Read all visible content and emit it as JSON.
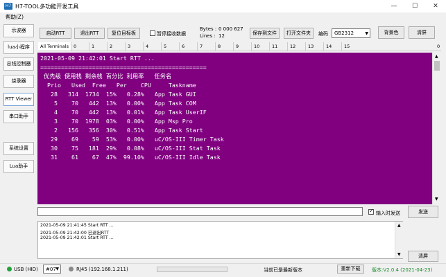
{
  "window": {
    "title": "H7-TOOL多功能开发工具",
    "icon_text": "H7"
  },
  "menu": {
    "help": "帮助(Z)"
  },
  "sidebar": {
    "items": [
      {
        "label": "示波器"
      },
      {
        "label": "lua小程序"
      },
      {
        "label": "总线控制器"
      },
      {
        "label": "烧录器"
      },
      {
        "label": "RTT Viewer"
      },
      {
        "label": "串口助手"
      },
      {
        "label": "系统设置"
      },
      {
        "label": "Lua助手"
      }
    ]
  },
  "toolbar": {
    "start_rtt": "启动RTT",
    "exit_rtt": "退出RTT",
    "reset_target": "复位目标板",
    "pause_label": "暂停接收数据",
    "bytes_label": "Bytes :",
    "bytes_value": "0 000 627",
    "lines_label": "Lines :",
    "lines_value": "12",
    "save_file": "保存到文件",
    "open_folder": "打开文件夹",
    "encoding_label": "编码",
    "encoding_value": "GB2312",
    "bg_color": "背景色",
    "clear": "清屏"
  },
  "tabs": [
    "All Terminals",
    "0",
    "1",
    "2",
    "3",
    "4",
    "5",
    "6",
    "7",
    "8",
    "9",
    "10",
    "11",
    "12",
    "13",
    "14",
    "15"
  ],
  "tab_right_label": "0",
  "terminal": {
    "background": "#800080",
    "lines": [
      "2021-05-09 21:42:01 Start RTT ...",
      "================================================",
      " 优先级 使用栈 剩余栈 百分比 利用率   任务名",
      "  Prio   Used  Free   Per    CPU     Taskname",
      "   28   314  1734  15%   0.28%   App Task GUI",
      "    5    70   442  13%   0.00%   App Task COM",
      "    4    70   442  13%   0.01%   App Task UserIF",
      "    3    70  1978  03%   0.00%   App Msp Pro",
      "    2   156   356  30%   0.51%   App Task Start",
      "   29    69    59  53%   0.00%   uC/OS-III Timer Task",
      "   30    75   181  29%   0.08%   uC/OS-III Stat Task",
      "   31    61    67  47%  99.10%   uC/OS-III Idle Task"
    ]
  },
  "send": {
    "input_value": "",
    "hex_send_label": "输入时发送",
    "send_button": "发送"
  },
  "log": {
    "lines": [
      "2021-05-09 21:41:45 Start RTT ...",
      "2021-05-09 21:42:00 已退出RTT",
      "2021-05-09 21:42:01 Start RTT ..."
    ],
    "clear": "清屏"
  },
  "status": {
    "usb": "USB (HID)",
    "usb_color": "#22a33a",
    "port": "#07",
    "rj45": "RJ45 (192.168.1.211)",
    "rj45_color": "#888888",
    "version_msg": "当前已是最新版本",
    "redownload": "重新下载",
    "version": "版本:V2.0.4 (2021-04-23)",
    "version_color": "#1a8a2a"
  }
}
